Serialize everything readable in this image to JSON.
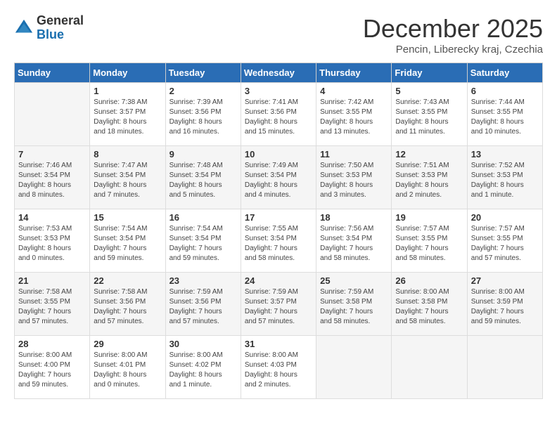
{
  "logo": {
    "general": "General",
    "blue": "Blue"
  },
  "title": "December 2025",
  "subtitle": "Pencin, Liberecky kraj, Czechia",
  "days_of_week": [
    "Sunday",
    "Monday",
    "Tuesday",
    "Wednesday",
    "Thursday",
    "Friday",
    "Saturday"
  ],
  "weeks": [
    [
      {
        "day": "",
        "info": ""
      },
      {
        "day": "1",
        "info": "Sunrise: 7:38 AM\nSunset: 3:57 PM\nDaylight: 8 hours\nand 18 minutes."
      },
      {
        "day": "2",
        "info": "Sunrise: 7:39 AM\nSunset: 3:56 PM\nDaylight: 8 hours\nand 16 minutes."
      },
      {
        "day": "3",
        "info": "Sunrise: 7:41 AM\nSunset: 3:56 PM\nDaylight: 8 hours\nand 15 minutes."
      },
      {
        "day": "4",
        "info": "Sunrise: 7:42 AM\nSunset: 3:55 PM\nDaylight: 8 hours\nand 13 minutes."
      },
      {
        "day": "5",
        "info": "Sunrise: 7:43 AM\nSunset: 3:55 PM\nDaylight: 8 hours\nand 11 minutes."
      },
      {
        "day": "6",
        "info": "Sunrise: 7:44 AM\nSunset: 3:55 PM\nDaylight: 8 hours\nand 10 minutes."
      }
    ],
    [
      {
        "day": "7",
        "info": "Sunrise: 7:46 AM\nSunset: 3:54 PM\nDaylight: 8 hours\nand 8 minutes."
      },
      {
        "day": "8",
        "info": "Sunrise: 7:47 AM\nSunset: 3:54 PM\nDaylight: 8 hours\nand 7 minutes."
      },
      {
        "day": "9",
        "info": "Sunrise: 7:48 AM\nSunset: 3:54 PM\nDaylight: 8 hours\nand 5 minutes."
      },
      {
        "day": "10",
        "info": "Sunrise: 7:49 AM\nSunset: 3:54 PM\nDaylight: 8 hours\nand 4 minutes."
      },
      {
        "day": "11",
        "info": "Sunrise: 7:50 AM\nSunset: 3:53 PM\nDaylight: 8 hours\nand 3 minutes."
      },
      {
        "day": "12",
        "info": "Sunrise: 7:51 AM\nSunset: 3:53 PM\nDaylight: 8 hours\nand 2 minutes."
      },
      {
        "day": "13",
        "info": "Sunrise: 7:52 AM\nSunset: 3:53 PM\nDaylight: 8 hours\nand 1 minute."
      }
    ],
    [
      {
        "day": "14",
        "info": "Sunrise: 7:53 AM\nSunset: 3:53 PM\nDaylight: 8 hours\nand 0 minutes."
      },
      {
        "day": "15",
        "info": "Sunrise: 7:54 AM\nSunset: 3:54 PM\nDaylight: 7 hours\nand 59 minutes."
      },
      {
        "day": "16",
        "info": "Sunrise: 7:54 AM\nSunset: 3:54 PM\nDaylight: 7 hours\nand 59 minutes."
      },
      {
        "day": "17",
        "info": "Sunrise: 7:55 AM\nSunset: 3:54 PM\nDaylight: 7 hours\nand 58 minutes."
      },
      {
        "day": "18",
        "info": "Sunrise: 7:56 AM\nSunset: 3:54 PM\nDaylight: 7 hours\nand 58 minutes."
      },
      {
        "day": "19",
        "info": "Sunrise: 7:57 AM\nSunset: 3:55 PM\nDaylight: 7 hours\nand 58 minutes."
      },
      {
        "day": "20",
        "info": "Sunrise: 7:57 AM\nSunset: 3:55 PM\nDaylight: 7 hours\nand 57 minutes."
      }
    ],
    [
      {
        "day": "21",
        "info": "Sunrise: 7:58 AM\nSunset: 3:55 PM\nDaylight: 7 hours\nand 57 minutes."
      },
      {
        "day": "22",
        "info": "Sunrise: 7:58 AM\nSunset: 3:56 PM\nDaylight: 7 hours\nand 57 minutes."
      },
      {
        "day": "23",
        "info": "Sunrise: 7:59 AM\nSunset: 3:56 PM\nDaylight: 7 hours\nand 57 minutes."
      },
      {
        "day": "24",
        "info": "Sunrise: 7:59 AM\nSunset: 3:57 PM\nDaylight: 7 hours\nand 57 minutes."
      },
      {
        "day": "25",
        "info": "Sunrise: 7:59 AM\nSunset: 3:58 PM\nDaylight: 7 hours\nand 58 minutes."
      },
      {
        "day": "26",
        "info": "Sunrise: 8:00 AM\nSunset: 3:58 PM\nDaylight: 7 hours\nand 58 minutes."
      },
      {
        "day": "27",
        "info": "Sunrise: 8:00 AM\nSunset: 3:59 PM\nDaylight: 7 hours\nand 59 minutes."
      }
    ],
    [
      {
        "day": "28",
        "info": "Sunrise: 8:00 AM\nSunset: 4:00 PM\nDaylight: 7 hours\nand 59 minutes."
      },
      {
        "day": "29",
        "info": "Sunrise: 8:00 AM\nSunset: 4:01 PM\nDaylight: 8 hours\nand 0 minutes."
      },
      {
        "day": "30",
        "info": "Sunrise: 8:00 AM\nSunset: 4:02 PM\nDaylight: 8 hours\nand 1 minute."
      },
      {
        "day": "31",
        "info": "Sunrise: 8:00 AM\nSunset: 4:03 PM\nDaylight: 8 hours\nand 2 minutes."
      },
      {
        "day": "",
        "info": ""
      },
      {
        "day": "",
        "info": ""
      },
      {
        "day": "",
        "info": ""
      }
    ]
  ]
}
